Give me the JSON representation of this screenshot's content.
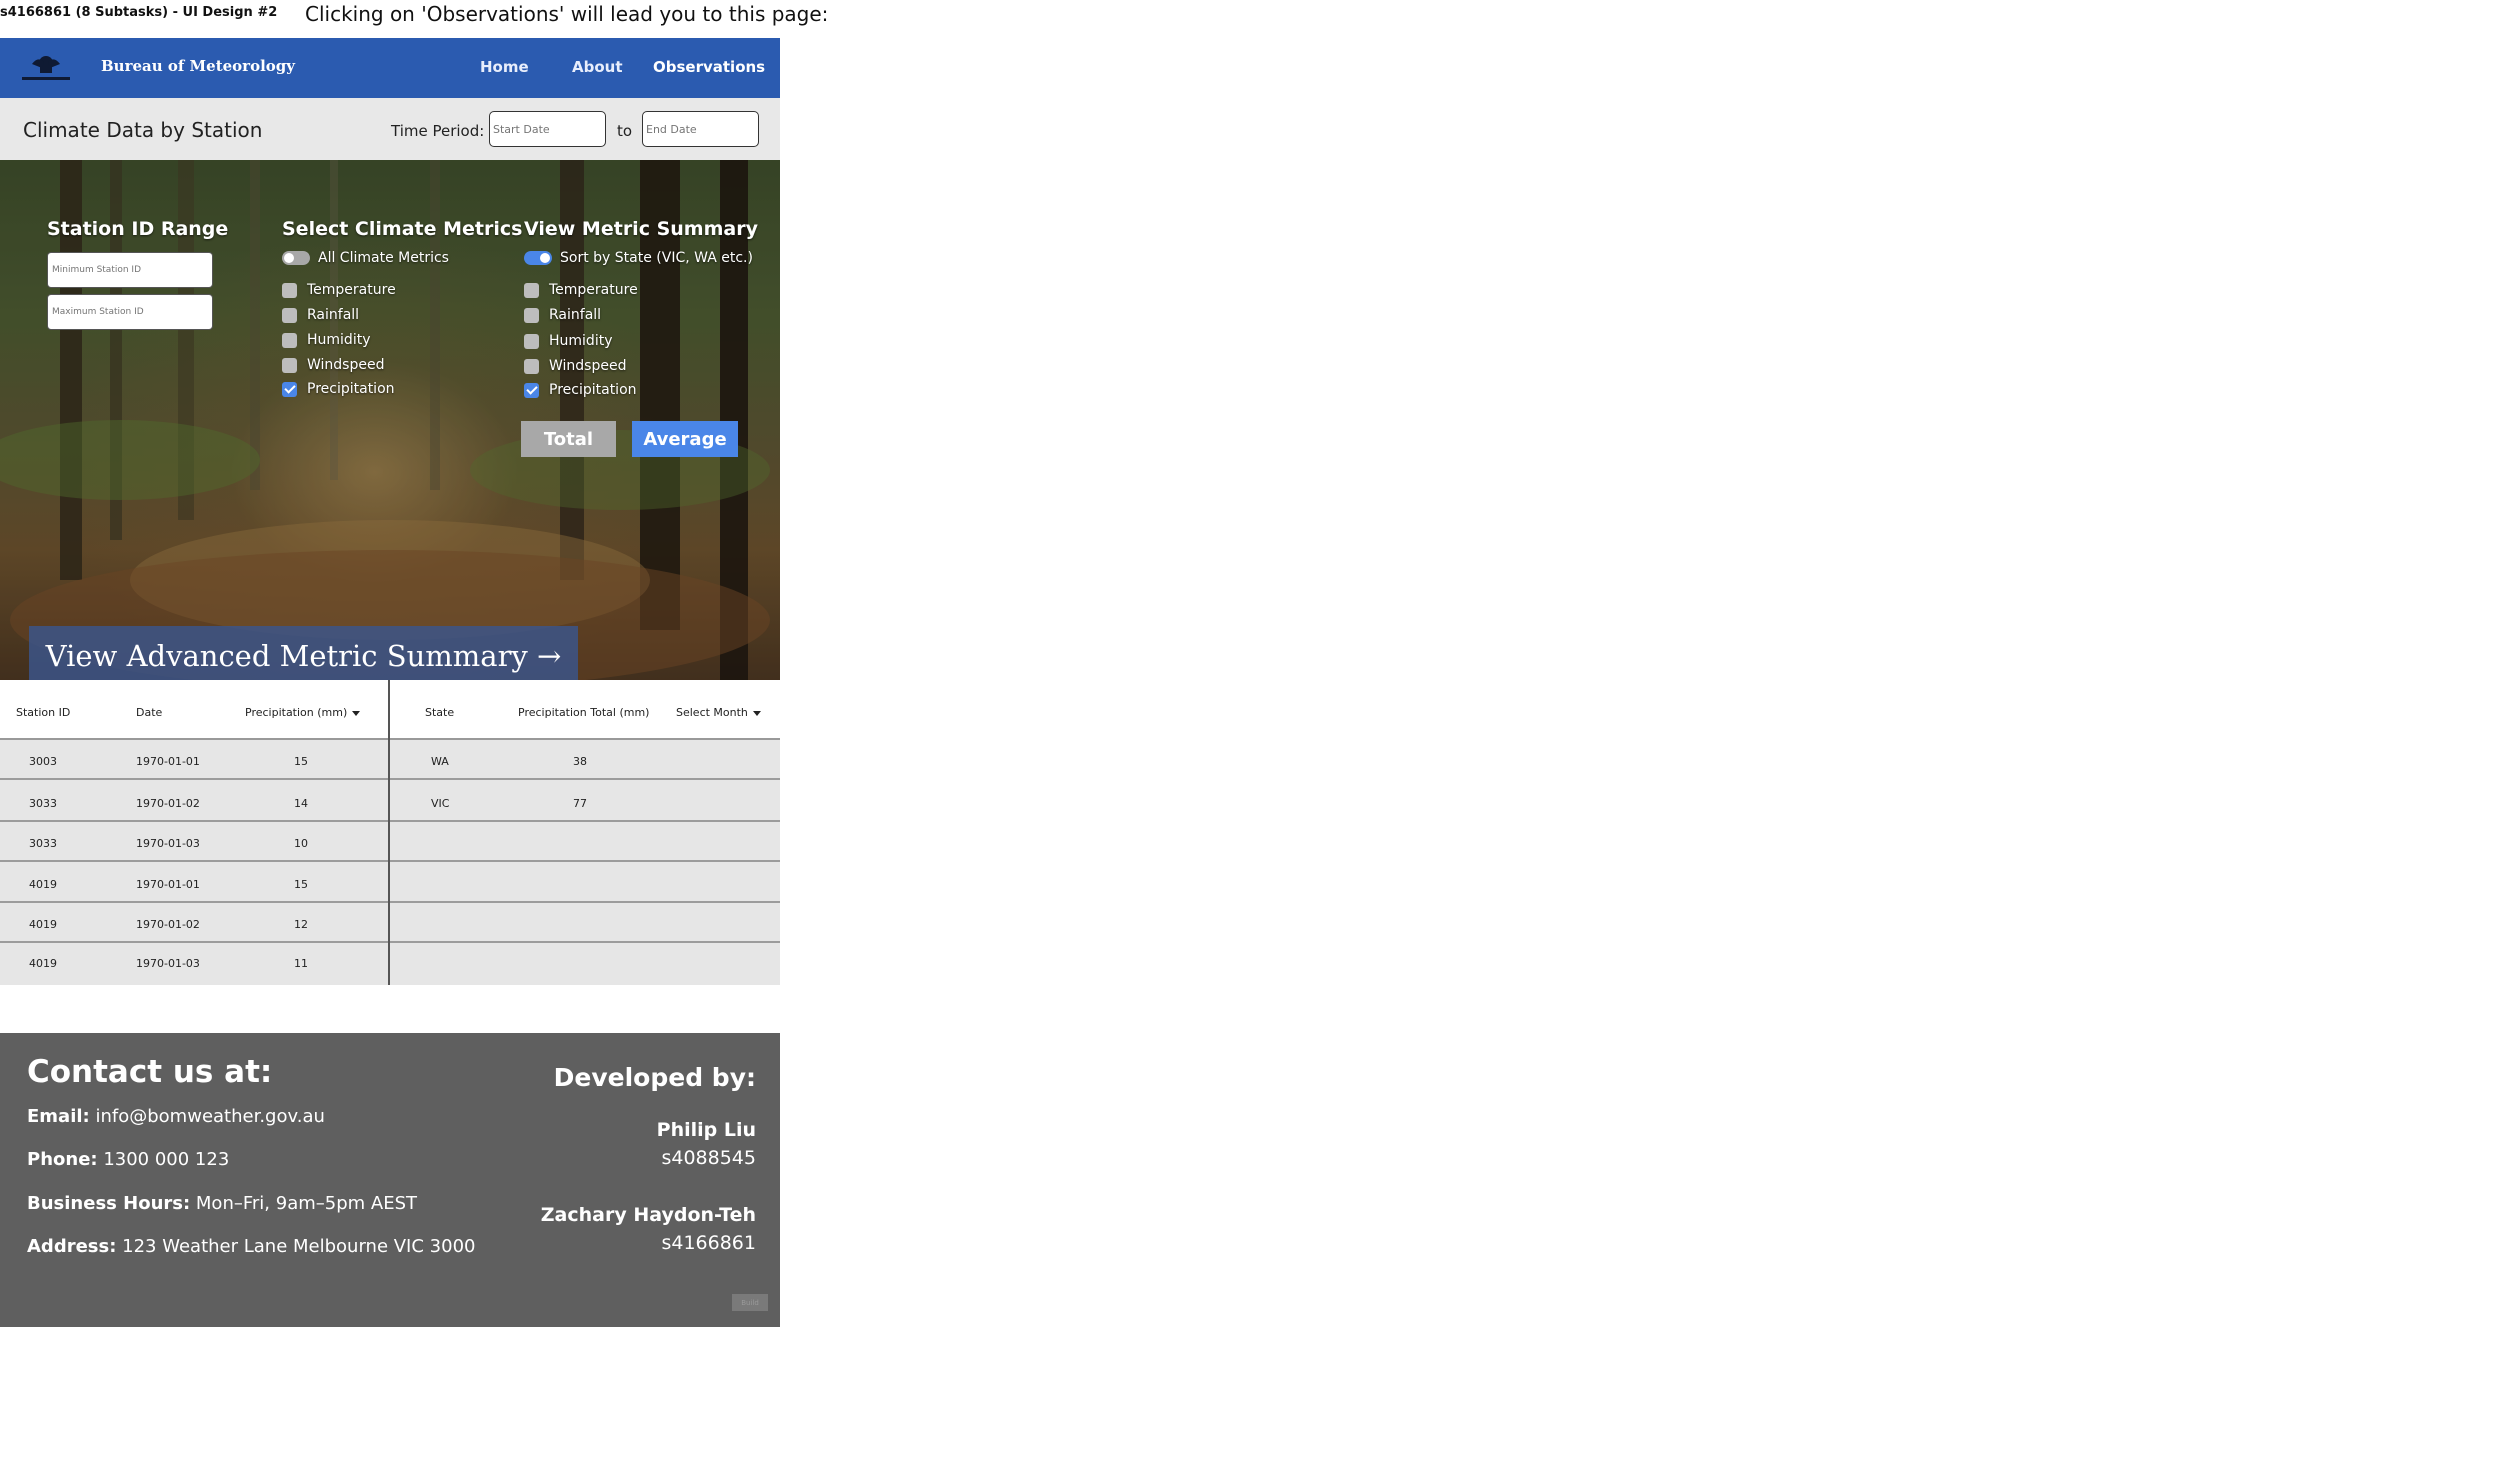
{
  "doc_title": "s4166861 (8 Subtasks) - UI Design #2",
  "caption": "Clicking on 'Observations' will lead you to this page:",
  "navbar": {
    "brand": "Bureau of Meteorology",
    "links": [
      "Home",
      "About",
      "Observations"
    ],
    "active": "Observations",
    "color": "#2b5bb0"
  },
  "filter": {
    "title": "Climate Data by Station",
    "time_period_label": "Time Period:",
    "start_placeholder": "Start Date",
    "to_label": "to",
    "end_placeholder": "End Date"
  },
  "station_range": {
    "heading": "Station ID Range",
    "min_placeholder": "Minimum Station ID",
    "max_placeholder": "Maximum Station ID"
  },
  "climate_metrics": {
    "heading": "Select Climate Metrics",
    "toggle_label": "All Climate Metrics",
    "toggle_on": false,
    "items": [
      {
        "label": "Temperature",
        "checked": false
      },
      {
        "label": "Rainfall",
        "checked": false
      },
      {
        "label": "Humidity",
        "checked": false
      },
      {
        "label": "Windspeed",
        "checked": false
      },
      {
        "label": "Precipitation",
        "checked": true
      }
    ]
  },
  "metric_summary": {
    "heading": "View Metric Summary",
    "toggle_label": "Sort by State (VIC, WA etc.)",
    "toggle_on": true,
    "items": [
      {
        "label": "Temperature",
        "checked": false
      },
      {
        "label": "Rainfall",
        "checked": false
      },
      {
        "label": "Humidity",
        "checked": false
      },
      {
        "label": "Windspeed",
        "checked": false
      },
      {
        "label": "Precipitation",
        "checked": true
      }
    ],
    "total_label": "Total",
    "average_label": "Average",
    "accent": "#4a86e8"
  },
  "advanced_button": "View Advanced Metric Summary →",
  "station_table": {
    "headers": [
      "Station ID",
      "Date",
      "Precipitation (mm)"
    ],
    "rows": [
      [
        "3003",
        "1970-01-01",
        "15"
      ],
      [
        "3033",
        "1970-01-02",
        "14"
      ],
      [
        "3033",
        "1970-01-03",
        "10"
      ],
      [
        "4019",
        "1970-01-01",
        "15"
      ],
      [
        "4019",
        "1970-01-02",
        "12"
      ],
      [
        "4019",
        "1970-01-03",
        "11"
      ]
    ]
  },
  "summary_table": {
    "headers": [
      "State",
      "Precipitation Total (mm)",
      "Select Month"
    ],
    "rows": [
      [
        "WA",
        "38"
      ],
      [
        "VIC",
        "77"
      ]
    ]
  },
  "footer": {
    "contact_title": "Contact us at:",
    "email_label": "Email:",
    "email": "info@bomweather.gov.au",
    "phone_label": "Phone:",
    "phone": "1300 000 123",
    "hours_label": "Business Hours:",
    "hours": "Mon–Fri, 9am–5pm AEST",
    "address_label": "Address:",
    "address": "123 Weather Lane Melbourne VIC 3000",
    "dev_title": "Developed by:",
    "dev1_name": "Philip Liu",
    "dev1_id": "s4088545",
    "dev2_name": "Zachary Haydon-Teh",
    "dev2_id": "s4166861",
    "tag": "Build"
  }
}
